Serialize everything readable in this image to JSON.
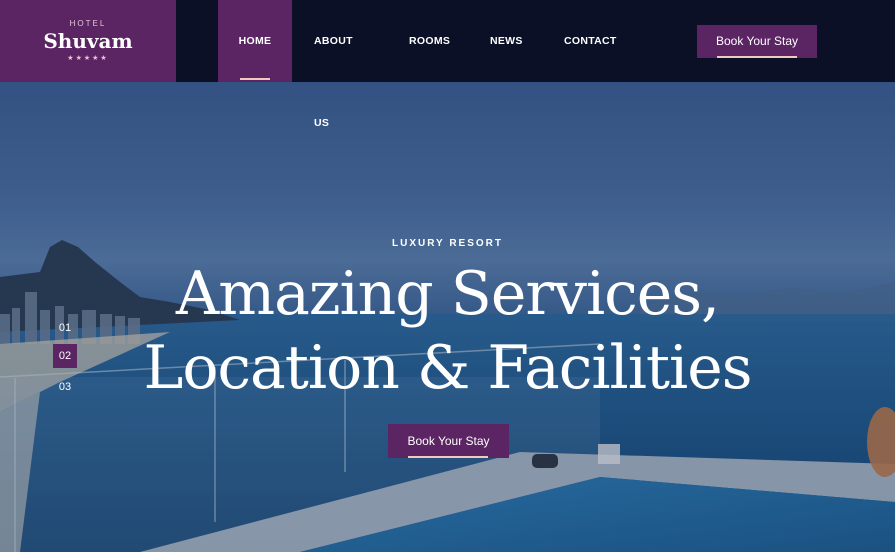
{
  "brand": {
    "hotel_label": "HOTEL",
    "name": "Shuvam",
    "stars": "★★★★★"
  },
  "nav": {
    "items": [
      {
        "label": "HOME",
        "active": true
      },
      {
        "label": "ABOUT US",
        "active": false
      },
      {
        "label": "ROOMS",
        "active": false
      },
      {
        "label": "NEWS",
        "active": false
      },
      {
        "label": "CONTACT",
        "active": false
      }
    ]
  },
  "header": {
    "book_label": "Book Your Stay"
  },
  "hero": {
    "eyebrow": "LUXURY RESORT",
    "headline_line1": "Amazing Services,",
    "headline_line2": "Location & Facilities",
    "button_label": "Book Your Stay",
    "slides": [
      "01",
      "02",
      "03"
    ],
    "active_slide": "02"
  },
  "colors": {
    "brand_purple": "#5b2463",
    "header_bg": "#0b1026",
    "accent_underline": "#f0c9c1"
  }
}
